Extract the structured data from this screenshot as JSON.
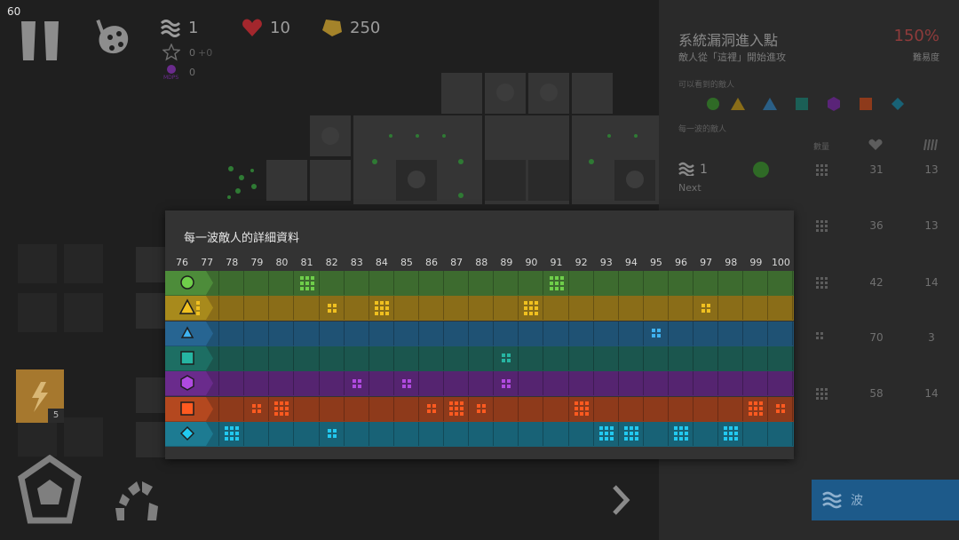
{
  "hud": {
    "fps": "60",
    "wave": "1",
    "lives": "10",
    "gold": "250",
    "stars": "0",
    "stars_bonus": "+0",
    "mdps_label": "MDPS",
    "mdps": "0",
    "ability_count": "5"
  },
  "side_panel": {
    "title": "系統漏洞進入點",
    "subtitle": "敵人從「這裡」開始進攻",
    "difficulty_pct": "150%",
    "difficulty_label": "難易度",
    "enemies_label": "可以看到的敵人",
    "per_wave_label": "每一波的敵人",
    "col_count": "數量",
    "next_wave": "1",
    "next_label": "Next",
    "wave_button_label": "波",
    "rows": [
      {
        "health": "31",
        "speed": "13"
      },
      {
        "health": "36",
        "speed": "13"
      },
      {
        "health": "42",
        "speed": "14"
      },
      {
        "health": "70",
        "speed": "3"
      },
      {
        "health": "58",
        "speed": "14"
      }
    ]
  },
  "modal": {
    "title": "每一波敵人的詳細資料",
    "waves": [
      "76",
      "77",
      "78",
      "79",
      "80",
      "81",
      "82",
      "83",
      "84",
      "85",
      "86",
      "87",
      "88",
      "89",
      "90",
      "91",
      "92",
      "93",
      "94",
      "95",
      "96",
      "97",
      "98",
      "99",
      "100"
    ],
    "rows": [
      {
        "shape": "circle",
        "icon": "circle-enemy-icon",
        "head": "#4d8c3a",
        "band": "#3d6b2f",
        "fg": "#6fcf4a",
        "cells": [
          {
            "w": "81",
            "n": 9
          },
          {
            "w": "91",
            "n": 9
          }
        ]
      },
      {
        "shape": "triangle",
        "icon": "triangle-enemy-icon",
        "head": "#a88a1c",
        "band": "#8a6d18",
        "fg": "#f0c020",
        "cells": [
          {
            "w": "77",
            "n": 3
          },
          {
            "w": "82",
            "n": 4
          },
          {
            "w": "84",
            "n": 9
          },
          {
            "w": "90",
            "n": 9
          },
          {
            "w": "97",
            "n": 4
          }
        ]
      },
      {
        "shape": "triangle-small",
        "icon": "blue-triangle-enemy-icon",
        "head": "#276592",
        "band": "#1f5274",
        "fg": "#3fb2f0",
        "cells": [
          {
            "w": "95",
            "n": 4
          }
        ]
      },
      {
        "shape": "square",
        "icon": "square-enemy-icon",
        "head": "#1d6e63",
        "band": "#1b564e",
        "fg": "#26b5a2",
        "cells": [
          {
            "w": "89",
            "n": 4
          }
        ]
      },
      {
        "shape": "hexagon",
        "icon": "hexagon-enemy-icon",
        "head": "#6a2b8c",
        "band": "#552470",
        "fg": "#b04ae0",
        "cells": [
          {
            "w": "83",
            "n": 4
          },
          {
            "w": "85",
            "n": 4
          },
          {
            "w": "89",
            "n": 4
          }
        ]
      },
      {
        "shape": "square-orange",
        "icon": "orange-square-enemy-icon",
        "head": "#b4481f",
        "band": "#8e3a1b",
        "fg": "#ff5a20",
        "cells": [
          {
            "w": "79",
            "n": 4
          },
          {
            "w": "80",
            "n": 9
          },
          {
            "w": "86",
            "n": 4
          },
          {
            "w": "87",
            "n": 9
          },
          {
            "w": "88",
            "n": 4
          },
          {
            "w": "92",
            "n": 9
          },
          {
            "w": "99",
            "n": 9
          },
          {
            "w": "100",
            "n": 4
          }
        ]
      },
      {
        "shape": "diamond",
        "icon": "diamond-enemy-icon",
        "head": "#1d7b92",
        "band": "#186276",
        "fg": "#22c9f0",
        "cells": [
          {
            "w": "78",
            "n": 9
          },
          {
            "w": "82",
            "n": 4
          },
          {
            "w": "93",
            "n": 9
          },
          {
            "w": "94",
            "n": 9
          },
          {
            "w": "96",
            "n": 9
          },
          {
            "w": "98",
            "n": 9
          }
        ]
      }
    ]
  }
}
